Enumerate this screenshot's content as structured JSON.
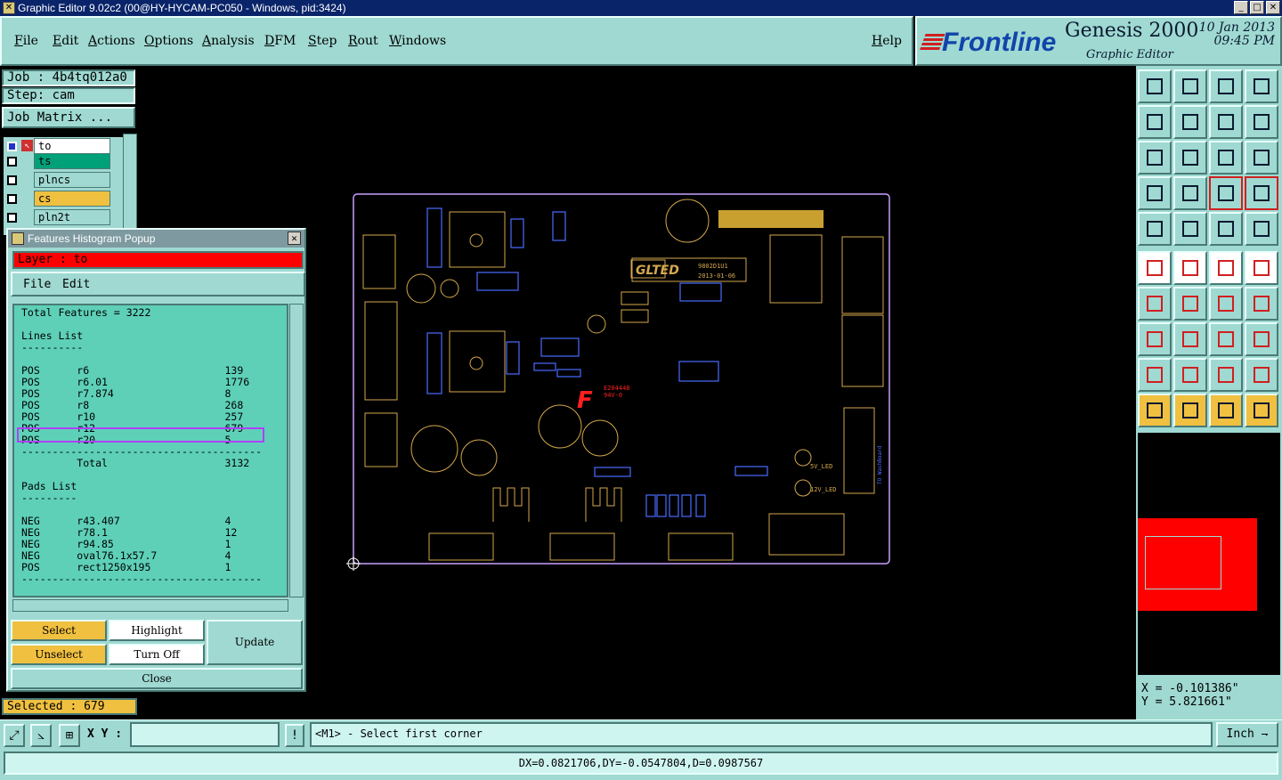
{
  "window": {
    "title": "Graphic Editor 9.02c2 (00@HY-HYCAM-PC050 - Windows, pid:3424)"
  },
  "menu": [
    "File",
    "Edit",
    "Actions",
    "Options",
    "Analysis",
    "DFM",
    "Step",
    "Rout",
    "Windows"
  ],
  "help_label": "Help",
  "brand": {
    "logo": "Frontline",
    "product": "Genesis 2000",
    "subtitle": "Graphic Editor",
    "date": "10 Jan 2013",
    "time": "09:45 PM"
  },
  "job": {
    "job_label": "Job : 4b4tq012a0",
    "step_label": "Step: cam",
    "matrix_button": "Job Matrix ..."
  },
  "layers": [
    {
      "name": "to",
      "color": "#ffffff"
    },
    {
      "name": "ts",
      "color": "#00a078"
    },
    {
      "name": "plncs",
      "color": "#9fd9d2"
    },
    {
      "name": "cs",
      "color": "#f0c040"
    },
    {
      "name": "pln2t",
      "color": "#9fd9d2"
    }
  ],
  "popup": {
    "title": "Features Histogram Popup",
    "layer_label": "Layer :  to",
    "menu_file": "File",
    "menu_edit": "Edit",
    "content": "Total Features = 3222\n\nLines List\n----------\n\nPOS      r6                      139\nPOS      r6.01                   1776\nPOS      r7.874                  8\nPOS      r8                      268\nPOS      r10                     257\nPOS      r12                     679\nPOS      r20                     5\n---------------------------------------\n         Total                   3132\n\nPads List\n---------\n\nNEG      r43.407                 4\nNEG      r78.1                   12\nNEG      r94.85                  1\nNEG      oval76.1x57.7           4\nPOS      rect1250x195            1\n---------------------------------------",
    "buttons": {
      "select": "Select",
      "unselect": "Unselect",
      "highlight": "Highlight",
      "turn_off": "Turn Off",
      "update": "Update",
      "close": "Close"
    }
  },
  "selected_label": "Selected : 679",
  "xy_label": "X Y :",
  "xy_value": "",
  "prompt": "<M1> - Select first corner",
  "units": "Inch",
  "coords": {
    "x": "X = -0.101386\"",
    "y": "Y = 5.821661\""
  },
  "measure": "DX=0.0821706,DY=-0.0547804,D=0.0987567",
  "board": {
    "silk_labels": [
      "GLTED",
      "9802D1U1",
      "2013-01-06",
      "E204448",
      "94V-0",
      "5V_LED",
      "12V_LED",
      "TO WashBoard"
    ],
    "colors": {
      "outline": "#c8a0ff",
      "silk": "#d4a84c",
      "parts": "#4a6cff",
      "marking": "#ff2020",
      "accent": "#9fd9d2"
    }
  }
}
